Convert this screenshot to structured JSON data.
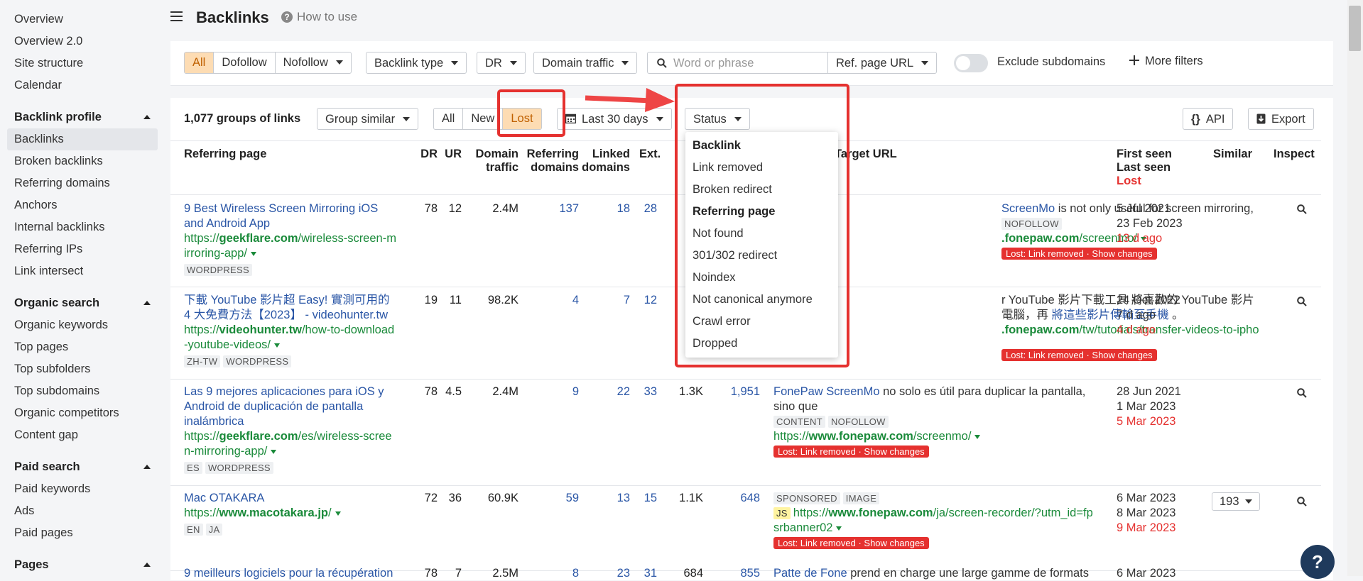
{
  "sidebar": {
    "items_top": [
      "Overview",
      "Overview 2.0",
      "Site structure",
      "Calendar"
    ],
    "sections": [
      {
        "title": "Backlink profile",
        "items": [
          "Backlinks",
          "Broken backlinks",
          "Referring domains",
          "Anchors",
          "Internal backlinks",
          "Referring IPs",
          "Link intersect"
        ]
      },
      {
        "title": "Organic search",
        "items": [
          "Organic keywords",
          "Top pages",
          "Top subfolders",
          "Top subdomains",
          "Organic competitors",
          "Content gap"
        ]
      },
      {
        "title": "Paid search",
        "items": [
          "Paid keywords",
          "Ads",
          "Paid pages"
        ]
      },
      {
        "title": "Pages",
        "items": []
      }
    ]
  },
  "header": {
    "title": "Backlinks",
    "help": "How to use"
  },
  "filters": {
    "seg": [
      "All",
      "Dofollow",
      "Nofollow"
    ],
    "backlink_type": "Backlink type",
    "dr": "DR",
    "domain_traffic": "Domain traffic",
    "search_placeholder": "Word or phrase",
    "ref_page_url": "Ref. page URL",
    "exclude": "Exclude subdomains",
    "more": "More filters"
  },
  "toolbar": {
    "count": "1,077 groups of links",
    "group": "Group similar",
    "tabs": [
      "All",
      "New",
      "Lost"
    ],
    "date": "Last 30 days",
    "status": "Status",
    "api": "API",
    "export": "Export"
  },
  "headers": {
    "ref": "Referring page",
    "dr": "DR",
    "ur": "UR",
    "dt1": "Domain",
    "dt2": "traffic",
    "rd1": "Referring",
    "rd2": "domains",
    "ld1": "Linked",
    "ld2": "domains",
    "ext": "Ext.",
    "target": "Target URL",
    "fs1": "First seen",
    "fs2": "Last seen",
    "fs3": "Lost",
    "similar": "Similar",
    "inspect": "Inspect"
  },
  "dropdown": {
    "groups": [
      {
        "head": "Backlink",
        "items": [
          "Link removed",
          "Broken redirect"
        ]
      },
      {
        "head": "Referring page",
        "items": [
          "Not found",
          "301/302 redirect",
          "Noindex",
          "Not canonical anymore",
          "Crawl error",
          "Dropped"
        ]
      }
    ]
  },
  "rows": [
    {
      "title1": "9 Best Wireless Screen Mirroring iOS",
      "title2": "and Android App",
      "url_pre": "https://",
      "url_dom": "geekflare.com",
      "url_path": "/wireless-screen-m",
      "url2": "irroring-app/",
      "tags": [
        "WORDPRESS"
      ],
      "dr": "78",
      "ur": "12",
      "traffic": "2.4M",
      "refdom": "137",
      "linked": "18",
      "ext": "28",
      "target_text_a": "ScreenMo",
      "target_text_b": " is not only useful for screen mirroring,",
      "target_tag": "NOFOLLOW",
      "target_url_dom": ".fonepaw.com",
      "target_url_path": "/screenmo/",
      "lost_badge": "Lost: Link removed",
      "show_changes": " · Show changes",
      "first": "5 Jul 2021",
      "last": "23 Feb 2023",
      "lost": "13 d ago"
    },
    {
      "title1": "下載 YouTube 影片超 Easy! 實測可用的",
      "title2": "4 大免費方法【2023】 - videohunter.tw",
      "url_pre": "https://",
      "url_dom": "videohunter.tw",
      "url_path": "/how-to-download",
      "url2": "-youtube-videos/",
      "tags": [
        "ZH-TW",
        "WORDPRESS"
      ],
      "dr": "19",
      "ur": "11",
      "traffic": "98.2K",
      "refdom": "4",
      "linked": "7",
      "ext": "12",
      "target_text_a": "r YouTube 影片下載工具 將喜歡的 YouTube 影片",
      "target_text_b": "電腦，再 ",
      "target_text_c": "將這些影片傳輸至手機",
      "target_url_dom": ".fonepaw.com",
      "target_url_path": "/tw/tutorials/transfer-videos-to-ipho",
      "lost_badge": "Lost: Link removed",
      "show_changes": " · Show changes",
      "first": "24 Oct 2022",
      "last": "7 d ago",
      "lost": "4 d ago"
    },
    {
      "title1": "Las 9 mejores aplicaciones para iOS y",
      "title2": "Android de duplicación de pantalla",
      "title3": "inalámbrica",
      "url_pre": "https://",
      "url_dom": "geekflare.com",
      "url_path": "/es/wireless-scree",
      "url2": "n-mirroring-app/",
      "tags": [
        "ES",
        "WORDPRESS"
      ],
      "dr": "78",
      "ur": "4.5",
      "traffic": "2.4M",
      "refdom": "9",
      "linked": "22",
      "ext": "33",
      "col9": "1.3K",
      "col10": "1,951",
      "target_text_a": "FonePaw ScreenMo",
      "target_text_b": " no solo es útil para duplicar la pantalla,",
      "target_text_c": "sino que",
      "target_tags": [
        "CONTENT",
        "NOFOLLOW"
      ],
      "target_url_pre": "https://",
      "target_url_dom": "www.fonepaw.com",
      "target_url_path": "/screenmo/",
      "lost_badge": "Lost: Link removed",
      "show_changes": " · Show changes",
      "first": "28 Jun 2021",
      "last": "1 Mar 2023",
      "lost": "5 Mar 2023"
    },
    {
      "title1": "Mac OTAKARA",
      "url_pre": "https://",
      "url_dom": "www.macotakara.jp",
      "url_path": "/",
      "tags": [
        "EN",
        "JA"
      ],
      "dr": "72",
      "ur": "36",
      "traffic": "60.9K",
      "refdom": "59",
      "linked": "13",
      "ext": "15",
      "col9": "1.1K",
      "col10": "648",
      "target_tags": [
        "SPONSORED",
        "IMAGE"
      ],
      "js": "JS",
      "target_url_pre": "https://",
      "target_url_dom": "www.fonepaw.com",
      "target_url_path": "/ja/screen-recorder/?utm_id=fp",
      "target_url2": "srbanner02",
      "lost_badge": "Lost: Link removed",
      "show_changes": " · Show changes",
      "first": "6 Mar 2023",
      "last": "8 Mar 2023",
      "lost": "9 Mar 2023",
      "similar": "193"
    },
    {
      "title1": "9 meilleurs logiciels pour la récupération",
      "dr": "78",
      "ur": "7",
      "traffic": "2.5M",
      "refdom": "8",
      "linked": "23",
      "ext": "31",
      "col9": "684",
      "col10": "855",
      "target_text_a": "Patte de Fone",
      "target_text_b": " prend en charge une large gamme de formats",
      "first": "6 Mar 2023"
    }
  ],
  "fab": "?"
}
